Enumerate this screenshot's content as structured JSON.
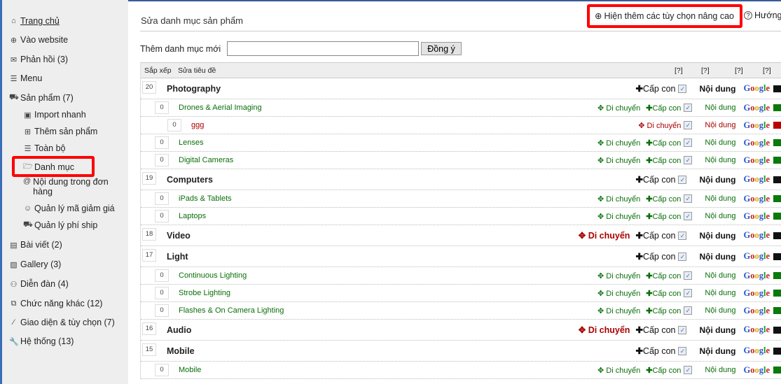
{
  "sidebar": {
    "items": [
      {
        "label": "Trang chủ",
        "icon": "home-icon",
        "sub": false
      },
      {
        "label": "Vào website",
        "icon": "globe-icon",
        "sub": false
      },
      {
        "label": "Phản hồi (3)",
        "icon": "mail-icon",
        "sub": false
      },
      {
        "label": "Menu",
        "icon": "list-icon",
        "sub": false
      },
      {
        "label": "Sản phẩm (7)",
        "icon": "truck-icon",
        "sub": false
      },
      {
        "label": "Import nhanh",
        "icon": "import-icon",
        "sub": true
      },
      {
        "label": "Thêm sản phẩm",
        "icon": "plus-box-icon",
        "sub": true
      },
      {
        "label": "Toàn bộ",
        "icon": "list-icon",
        "sub": true
      },
      {
        "label": "Danh mục",
        "icon": "folder-icon",
        "sub": true,
        "active": true
      },
      {
        "label": "Nội dung trong đơn hàng",
        "icon": "at-icon",
        "sub": true
      },
      {
        "label": "Quản lý mã giảm giá",
        "icon": "smile-icon",
        "sub": true
      },
      {
        "label": "Quản lý phí ship",
        "icon": "truck-icon",
        "sub": true
      },
      {
        "label": "Bài viết (2)",
        "icon": "document-icon",
        "sub": false
      },
      {
        "label": "Gallery (3)",
        "icon": "image-icon",
        "sub": false
      },
      {
        "label": "Diễn đàn (4)",
        "icon": "users-icon",
        "sub": false
      },
      {
        "label": "Chức năng khác (12)",
        "icon": "puzzle-icon",
        "sub": false
      },
      {
        "label": "Giao diện & tùy chọn (7)",
        "icon": "brush-icon",
        "sub": false
      },
      {
        "label": "Hệ thống (13)",
        "icon": "wrench-icon",
        "sub": false
      }
    ]
  },
  "header": {
    "title": "Sửa danh mục sản phẩm",
    "advanced": "Hiện thêm các tùy chọn nâng cao",
    "help": "Hướng"
  },
  "add": {
    "label": "Thêm danh mục mới",
    "value": "",
    "button": "Đồng ý"
  },
  "table": {
    "col_order": "Sắp xếp",
    "col_title": "Sửa tiêu đề",
    "help_marks": [
      "[?]",
      "[?]",
      "[?]",
      "[?]"
    ],
    "labels": {
      "move": "Di chuyển",
      "child": "Cấp con",
      "content": "Nội dung",
      "google": "Google"
    },
    "rows": [
      {
        "order": "20",
        "name": "Photography",
        "level": 1,
        "move": false,
        "child": true,
        "checked": true
      },
      {
        "order": "0",
        "name": "Drones & Aerial Imaging",
        "level": 2,
        "move": true,
        "child": true,
        "checked": true
      },
      {
        "order": "0",
        "name": "ggg",
        "level": 3,
        "move": true,
        "child": false,
        "checked": true,
        "disabled": true
      },
      {
        "order": "0",
        "name": "Lenses",
        "level": 2,
        "move": true,
        "child": true,
        "checked": true
      },
      {
        "order": "0",
        "name": "Digital Cameras",
        "level": 2,
        "move": true,
        "child": true,
        "checked": true
      },
      {
        "order": "19",
        "name": "Computers",
        "level": 1,
        "move": false,
        "child": true,
        "checked": true
      },
      {
        "order": "0",
        "name": "iPads & Tablets",
        "level": 2,
        "move": true,
        "child": true,
        "checked": true
      },
      {
        "order": "0",
        "name": "Laptops",
        "level": 2,
        "move": true,
        "child": true,
        "checked": true
      },
      {
        "order": "18",
        "name": "Video",
        "level": 1,
        "move": true,
        "child": true,
        "checked": true
      },
      {
        "order": "17",
        "name": "Light",
        "level": 1,
        "move": false,
        "child": true,
        "checked": true
      },
      {
        "order": "0",
        "name": "Continuous Lighting",
        "level": 2,
        "move": true,
        "child": true,
        "checked": true
      },
      {
        "order": "0",
        "name": "Strobe Lighting",
        "level": 2,
        "move": true,
        "child": true,
        "checked": true
      },
      {
        "order": "0",
        "name": "Flashes & On Camera Lighting",
        "level": 2,
        "move": true,
        "child": true,
        "checked": true
      },
      {
        "order": "16",
        "name": "Audio",
        "level": 1,
        "move": true,
        "child": true,
        "checked": true
      },
      {
        "order": "15",
        "name": "Mobile",
        "level": 1,
        "move": false,
        "child": true,
        "checked": true
      },
      {
        "order": "0",
        "name": "Mobile",
        "level": 2,
        "move": true,
        "child": true,
        "checked": true
      }
    ]
  },
  "colors": {
    "accent": "#3a6fb7",
    "green": "#0a6e0a",
    "red": "#aa0000",
    "highlight": "#ff0000"
  }
}
